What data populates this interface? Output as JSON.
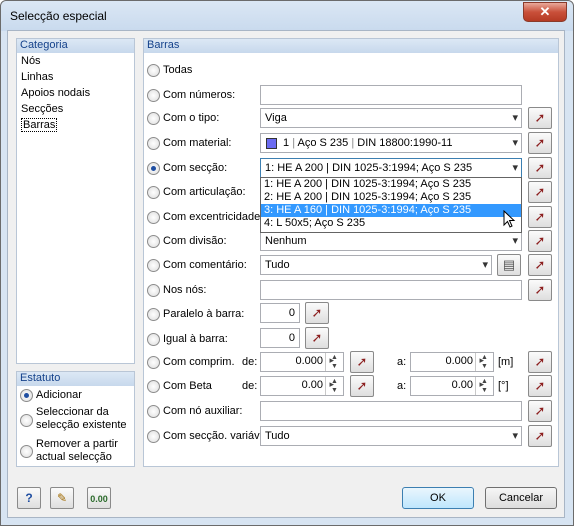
{
  "window": {
    "title": "Selecção especial",
    "close": "✕"
  },
  "categoria": {
    "header": "Categoria",
    "items": [
      "Nós",
      "Linhas",
      "Apoios nodais",
      "Secções",
      "Barras"
    ],
    "selected": "Barras"
  },
  "estatuto": {
    "header": "Estatuto",
    "options": [
      {
        "label": "Adicionar",
        "checked": true
      },
      {
        "label_line1": "Seleccionar da",
        "label_line2": "selecção existente",
        "checked": false
      },
      {
        "label_line1": "Remover a partir",
        "label_line2": "actual selecção",
        "checked": false
      }
    ]
  },
  "barras": {
    "header": "Barras",
    "todas": "Todas",
    "com_numeros": "Com números:",
    "com_numeros_value": "",
    "com_o_tipo": "Com o tipo:",
    "com_o_tipo_value": "Viga",
    "com_material": "Com material:",
    "material_num": "1",
    "material_name": "Aço S 235",
    "material_norm": "DIN 18800:1990-11",
    "material_color": "#6b6bf0",
    "com_seccao": "Com secção:",
    "seccao_value": "1: HE A 200 | DIN 1025-3:1994; Aço S 235",
    "seccao_options": [
      "1: HE A 200 | DIN 1025-3:1994; Aço S 235",
      "2: HE A 200 | DIN 1025-3:1994; Aço S 235",
      "3: HE A 160 | DIN 1025-3:1994; Aço S 235",
      "4: L 50x5; Aço S 235"
    ],
    "seccao_highlighted": 2,
    "com_articulacao": "Com articulação:",
    "com_excentricidade": "Com excentricidade:",
    "com_divisao": "Com divisão:",
    "divisao_value": "Nenhum",
    "com_comentario": "Com comentário:",
    "comentario_value": "Tudo",
    "nos_nos": "Nos nós:",
    "nos_nos_value": "",
    "paralelo": "Paralelo à barra:",
    "paralelo_value": "0",
    "igual": "Igual à barra:",
    "igual_value": "0",
    "com_comprim": "Com comprim.",
    "de": "de:",
    "a": "a:",
    "comprim_de": "0.000",
    "comprim_a": "0.000",
    "comprim_unit": "[m]",
    "com_beta": "Com Beta",
    "beta_de": "0.00",
    "beta_a": "0.00",
    "beta_unit": "[°]",
    "com_no_aux": "Com nó auxiliar:",
    "no_aux_value": "",
    "com_seccao_variav": "Com secção. variáv",
    "seccao_variav_value": "Tudo"
  },
  "buttons": {
    "ok": "OK",
    "cancel": "Cancelar"
  }
}
